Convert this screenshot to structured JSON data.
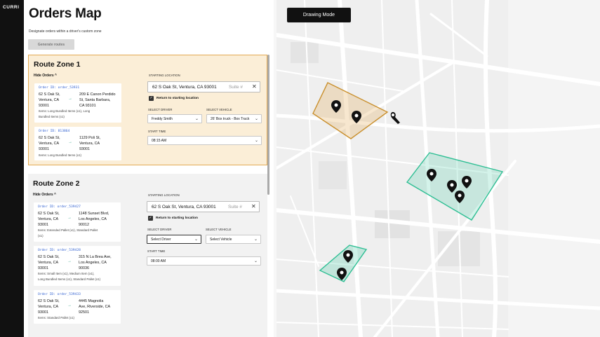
{
  "app": {
    "logo": "CURRI"
  },
  "header": {
    "title": "Orders Map",
    "subtitle": "Designate orders within a driver's custom zone",
    "generate_label": "Generate routes"
  },
  "map": {
    "drawing_mode_label": "Drawing Mode"
  },
  "zones": [
    {
      "title": "Route Zone 1",
      "hide_label": "Hide Orders ^",
      "starting_location_label": "STARTING LOCATION",
      "location_value": "62 S Oak St, Ventura, CA 93001",
      "suite_placeholder": "Suite #",
      "clear": "✕",
      "return_label": "Return to starting location",
      "select_driver_label": "SELECT DRIVER",
      "select_vehicle_label": "SELECT VEHICLE",
      "driver_value": "Freddy Smith",
      "vehicle_value": "26' Box truck - Box Truck",
      "start_time_label": "START TIME",
      "start_time_value": "08:15 AM",
      "color": "#e3a951",
      "orders": [
        {
          "id": "Order ID: order_53931",
          "from": [
            "62 S Oak St,",
            "Ventura, CA",
            "93001"
          ],
          "to": [
            "209 E Canon Perdido",
            "St, Santa Barbara,",
            "CA 93101"
          ],
          "items": [
            "Items: Long Bundled Items (x1), Long",
            "Bundled Items (x1)"
          ]
        },
        {
          "id": "Order ID: 813864",
          "from": [
            "62 S Oak St,",
            "Ventura, CA",
            "93001"
          ],
          "to": [
            "1129 Poli St,",
            "Ventura, CA",
            "93001"
          ],
          "items": [
            "Items: Long Bundled Items (x1)"
          ]
        }
      ]
    },
    {
      "title": "Route Zone 2",
      "hide_label": "Hide Orders ^",
      "starting_location_label": "STARTING LOCATION",
      "location_value": "62 S Oak St, Ventura, CA 93001",
      "suite_placeholder": "Suite #",
      "clear": "✕",
      "return_label": "Return to starting location",
      "select_driver_label": "SELECT DRIVER",
      "select_vehicle_label": "SELECT VEHICLE",
      "driver_value": "Select Driver",
      "vehicle_value": "Select Vehicle",
      "start_time_label": "START TIME",
      "start_time_value": "08:00 AM",
      "color": "#3cc8a0",
      "orders": [
        {
          "id": "Order ID: order_539427",
          "from": [
            "62 S Oak St,",
            "Ventura, CA",
            "93001"
          ],
          "to": [
            "1148 Sunset Blvd,",
            "Los Angeles, CA",
            "90012"
          ],
          "items": [
            "Items: Extended Pallet (x1), Standard Pallet",
            "(x1)"
          ]
        },
        {
          "id": "Order ID: order_539428",
          "from": [
            "62 S Oak St,",
            "Ventura, CA",
            "93001"
          ],
          "to": [
            "315 N La Brea Ave,",
            "Los Angeles, CA",
            "90036"
          ],
          "items": [
            "Items: Small Item (x1), Medium Item (x1),",
            "Long Bundled Items (x1), Standard Pallet (x1)"
          ]
        },
        {
          "id": "Order ID: order_539433",
          "from": [
            "62 S Oak St,",
            "Ventura, CA",
            "93001"
          ],
          "to": [
            "4445 Magnolia",
            "Ave, Riverside, CA",
            "92501"
          ],
          "items": [
            "Items: Standard Pallet (x1)"
          ]
        }
      ]
    }
  ],
  "icons": {
    "arrow": "→",
    "chevron": "⌄",
    "check": "✓"
  }
}
